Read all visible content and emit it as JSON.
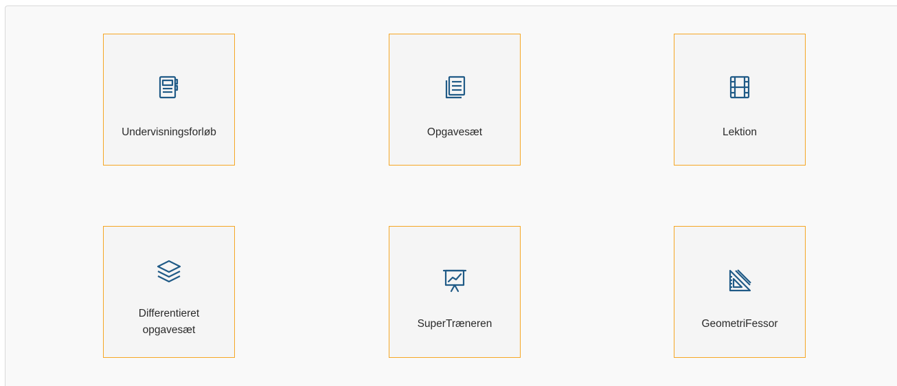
{
  "accent_color": "#f5a623",
  "icon_color": "#1f5a86",
  "tiles": [
    {
      "label": "Undervisningsforløb",
      "icon": "notebook-icon"
    },
    {
      "label": "Opgavesæt",
      "icon": "document-stack-icon"
    },
    {
      "label": "Lektion",
      "icon": "film-icon"
    },
    {
      "label_line1": "Differentieret",
      "label_line2": "opgavesæt",
      "icon": "layers-icon"
    },
    {
      "label": "SuperTræneren",
      "icon": "presentation-chart-icon"
    },
    {
      "label": "GeometriFessor",
      "icon": "set-square-icon"
    }
  ]
}
